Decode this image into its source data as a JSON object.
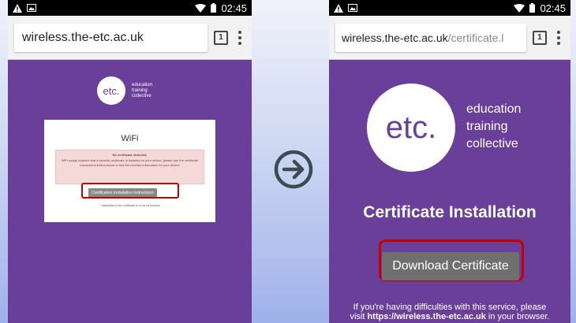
{
  "left_phone": {
    "status": {
      "time": "02:45"
    },
    "browser": {
      "url": "wireless.the-etc.ac.uk",
      "tab_count": "1"
    },
    "logo": {
      "mark": "etc.",
      "tagline": [
        "education",
        "training",
        "collective"
      ]
    },
    "card": {
      "title": "WiFi",
      "alert_title": "No certificate detected.",
      "alert_body": "WiFi usage requires that a security certificate is installed on your device; please use the certificate instructions button below to find the revelant information for your device",
      "button_label": "Certification Installation Instructions",
      "note": "* Installation of the certificate is a one-off process"
    }
  },
  "right_phone": {
    "status": {
      "time": "02:45"
    },
    "browser": {
      "url_host": "wireless.the-etc.ac.uk",
      "url_path": "/certificate.l",
      "tab_count": "1"
    },
    "logo": {
      "mark": "etc.",
      "tagline": [
        "education",
        "training",
        "collective"
      ]
    },
    "title": "Certificate Installation",
    "button_label": "Download Certificate",
    "help_line1": "If you're having difficulties with this service, please",
    "help_prefix": "visit ",
    "help_link": "https://wireless.the-etc.ac.uk",
    "help_suffix": " in your browser."
  },
  "icons": {
    "arrow": "circle-arrow-right-icon",
    "status": [
      "warning-icon",
      "image-icon",
      "wifi-icon",
      "battery-icon"
    ]
  },
  "colors": {
    "page_purple": "#6a3f99",
    "highlight_red": "#c40000",
    "button_gray": "#6f6f6f"
  }
}
